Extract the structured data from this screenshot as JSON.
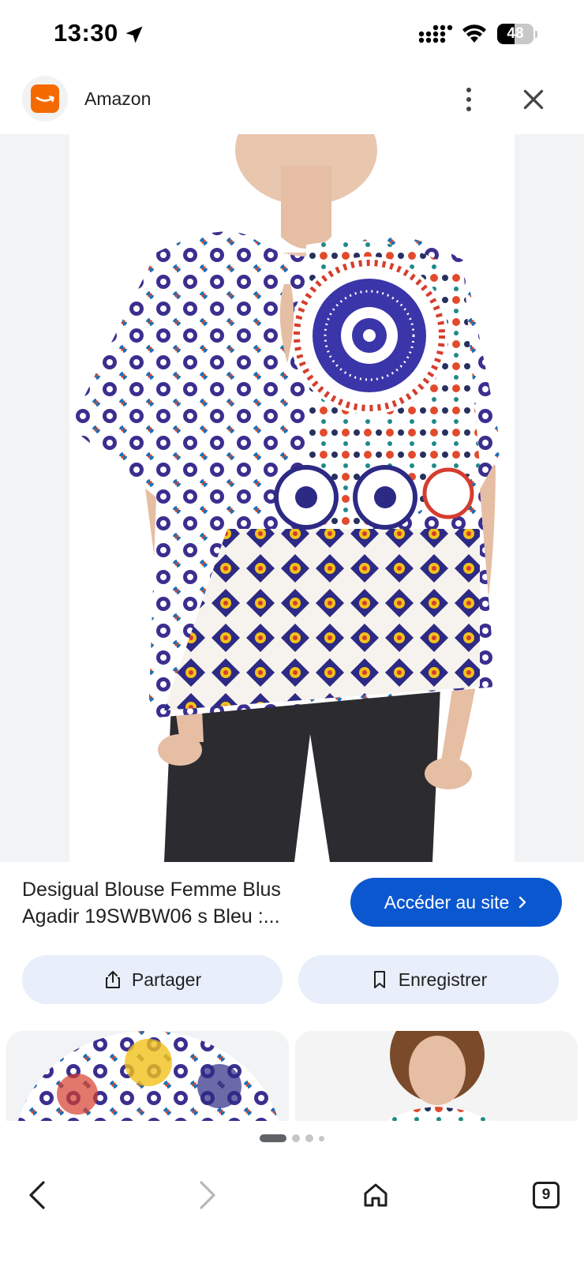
{
  "status_bar": {
    "time": "13:30",
    "battery_level": "48",
    "battery_fraction": 0.48,
    "icons": [
      "location-arrow-icon",
      "cellular-signal-icon",
      "wifi-icon",
      "battery-icon"
    ]
  },
  "header": {
    "site_name": "Amazon",
    "logo_icon": "amazon-logo",
    "brand_color": "#f56a00",
    "menu_icon": "more-vert-icon",
    "close_icon": "close-icon"
  },
  "product": {
    "title": "Desigual Blouse Femme Blus Agadir 19SWBW06 s Bleu :...",
    "visit_label": "Accéder au site",
    "visit_color": "#0b57d0"
  },
  "actions": {
    "share_label": "Partager",
    "save_label": "Enregistrer"
  },
  "pager": {
    "pages": 4,
    "active": 1
  },
  "nav": {
    "back_icon": "back-arrow-icon",
    "forward_icon": "forward-arrow-icon",
    "home_icon": "home-icon",
    "tabs_count": "9"
  }
}
